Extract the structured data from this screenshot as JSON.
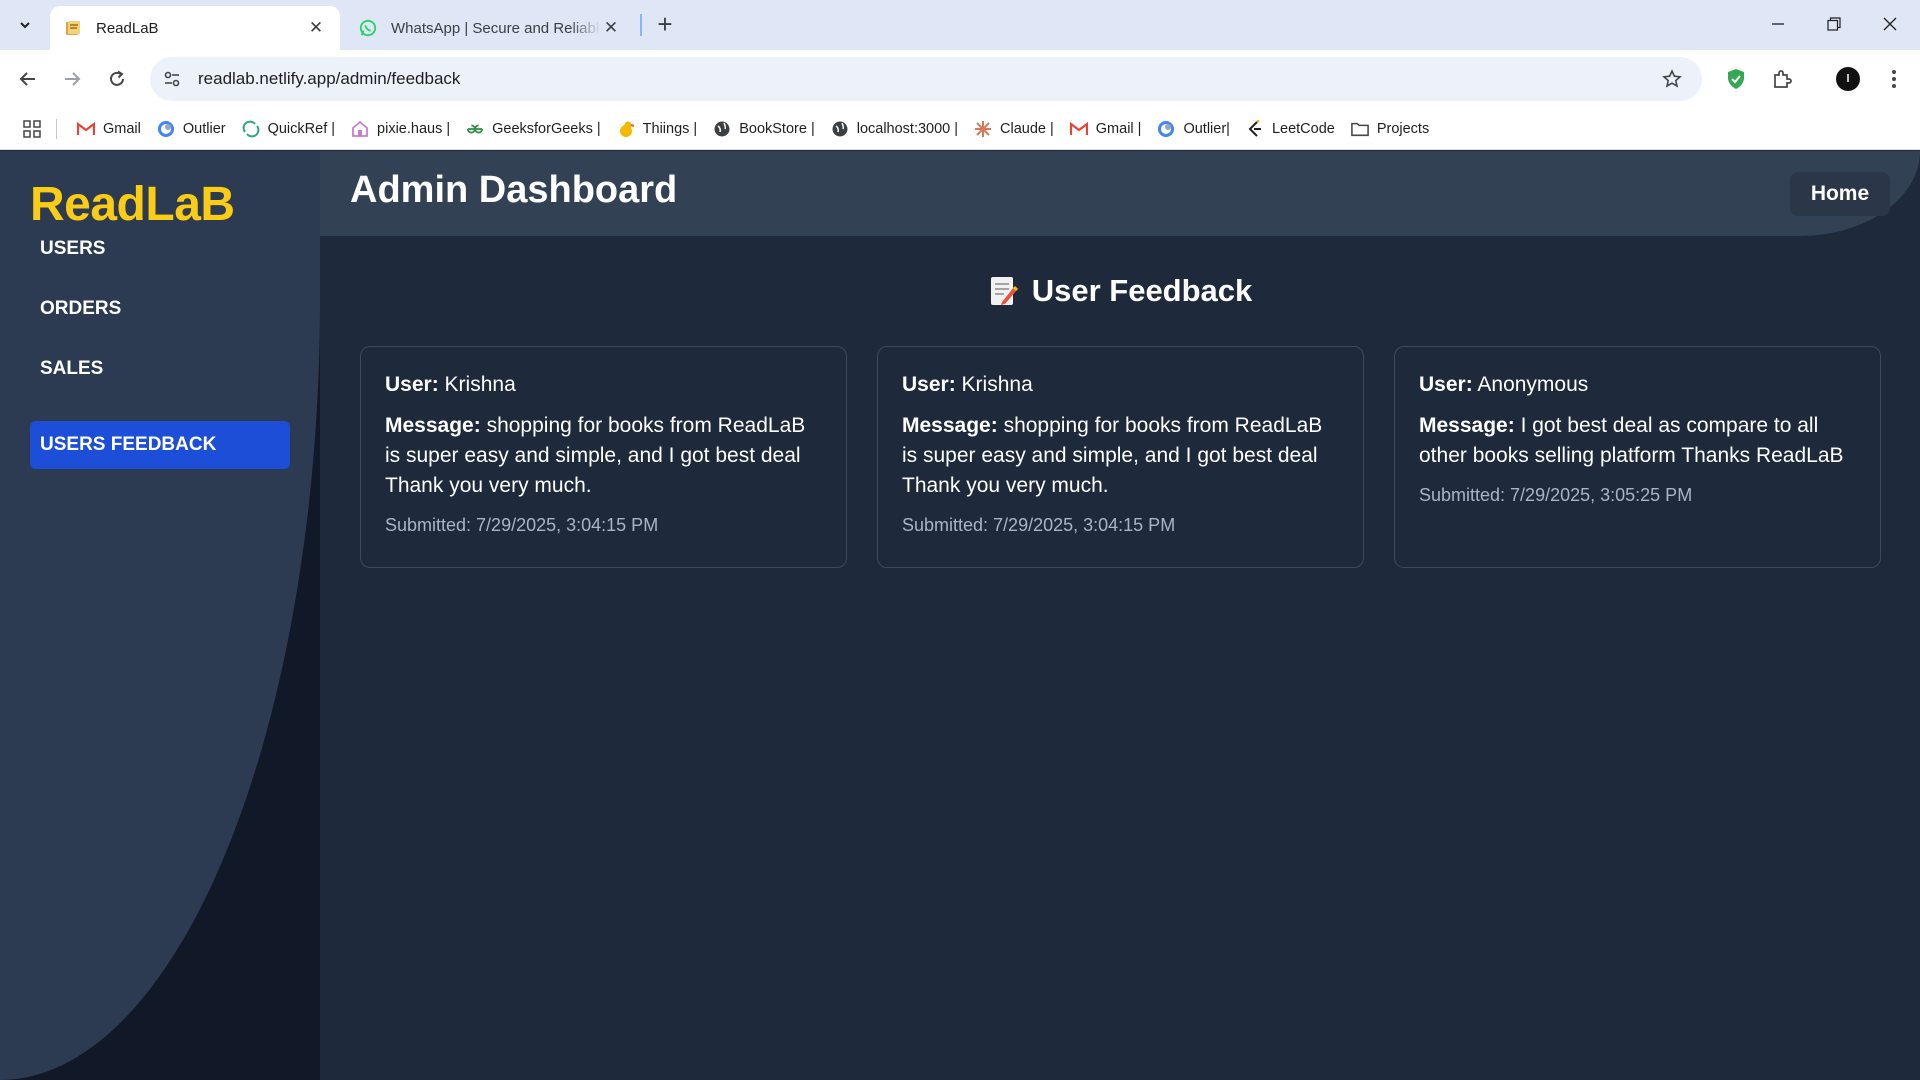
{
  "browser": {
    "tabs": [
      {
        "title": "ReadLaB",
        "active": true
      },
      {
        "title": "WhatsApp | Secure and Reliable",
        "active": false
      }
    ],
    "url": "readlab.netlify.app/admin/feedback",
    "bookmarks": [
      {
        "label": "Gmail",
        "icon": "gmail-icon"
      },
      {
        "label": "Outlier",
        "icon": "outlier-icon"
      },
      {
        "label": "QuickRef |",
        "icon": "quickref-icon"
      },
      {
        "label": "pixie.haus |",
        "icon": "pixie-icon"
      },
      {
        "label": "GeeksforGeeks |",
        "icon": "gfg-icon"
      },
      {
        "label": "Thiings |",
        "icon": "thiings-icon"
      },
      {
        "label": "BookStore |",
        "icon": "globe-icon"
      },
      {
        "label": "localhost:3000 |",
        "icon": "globe-icon"
      },
      {
        "label": "Claude |",
        "icon": "claude-icon"
      },
      {
        "label": "Gmail |",
        "icon": "gmail-icon"
      },
      {
        "label": "Outlier|",
        "icon": "outlier-icon"
      },
      {
        "label": "LeetCode",
        "icon": "leetcode-icon"
      },
      {
        "label": "Projects",
        "icon": "folder-icon"
      }
    ]
  },
  "app": {
    "brand": "ReadLaB",
    "nav": [
      {
        "label": "USERS",
        "active": false
      },
      {
        "label": "ORDERS",
        "active": false
      },
      {
        "label": "SALES",
        "active": false
      },
      {
        "label": "USERS FEEDBACK",
        "active": true
      }
    ],
    "header": {
      "title": "Admin Dashboard",
      "home": "Home"
    },
    "section_title": "User Feedback",
    "labels": {
      "user": "User:",
      "message": "Message:"
    },
    "feedback": [
      {
        "user": "Krishna",
        "message": "shopping for books from ReadLaB is super easy and simple, and I got best deal Thank you very much.",
        "submitted": "Submitted: 7/29/2025, 3:04:15 PM"
      },
      {
        "user": "Krishna",
        "message": "shopping for books from ReadLaB is super easy and simple, and I got best deal Thank you very much.",
        "submitted": "Submitted: 7/29/2025, 3:04:15 PM"
      },
      {
        "user": "Anonymous",
        "message": "I got best deal as compare to all other books selling platform Thanks ReadLaB",
        "submitted": "Submitted: 7/29/2025, 3:05:25 PM"
      }
    ],
    "colors": {
      "brand": "#facc15",
      "active_nav": "#1d4ed8",
      "background": "#1e293b"
    }
  }
}
